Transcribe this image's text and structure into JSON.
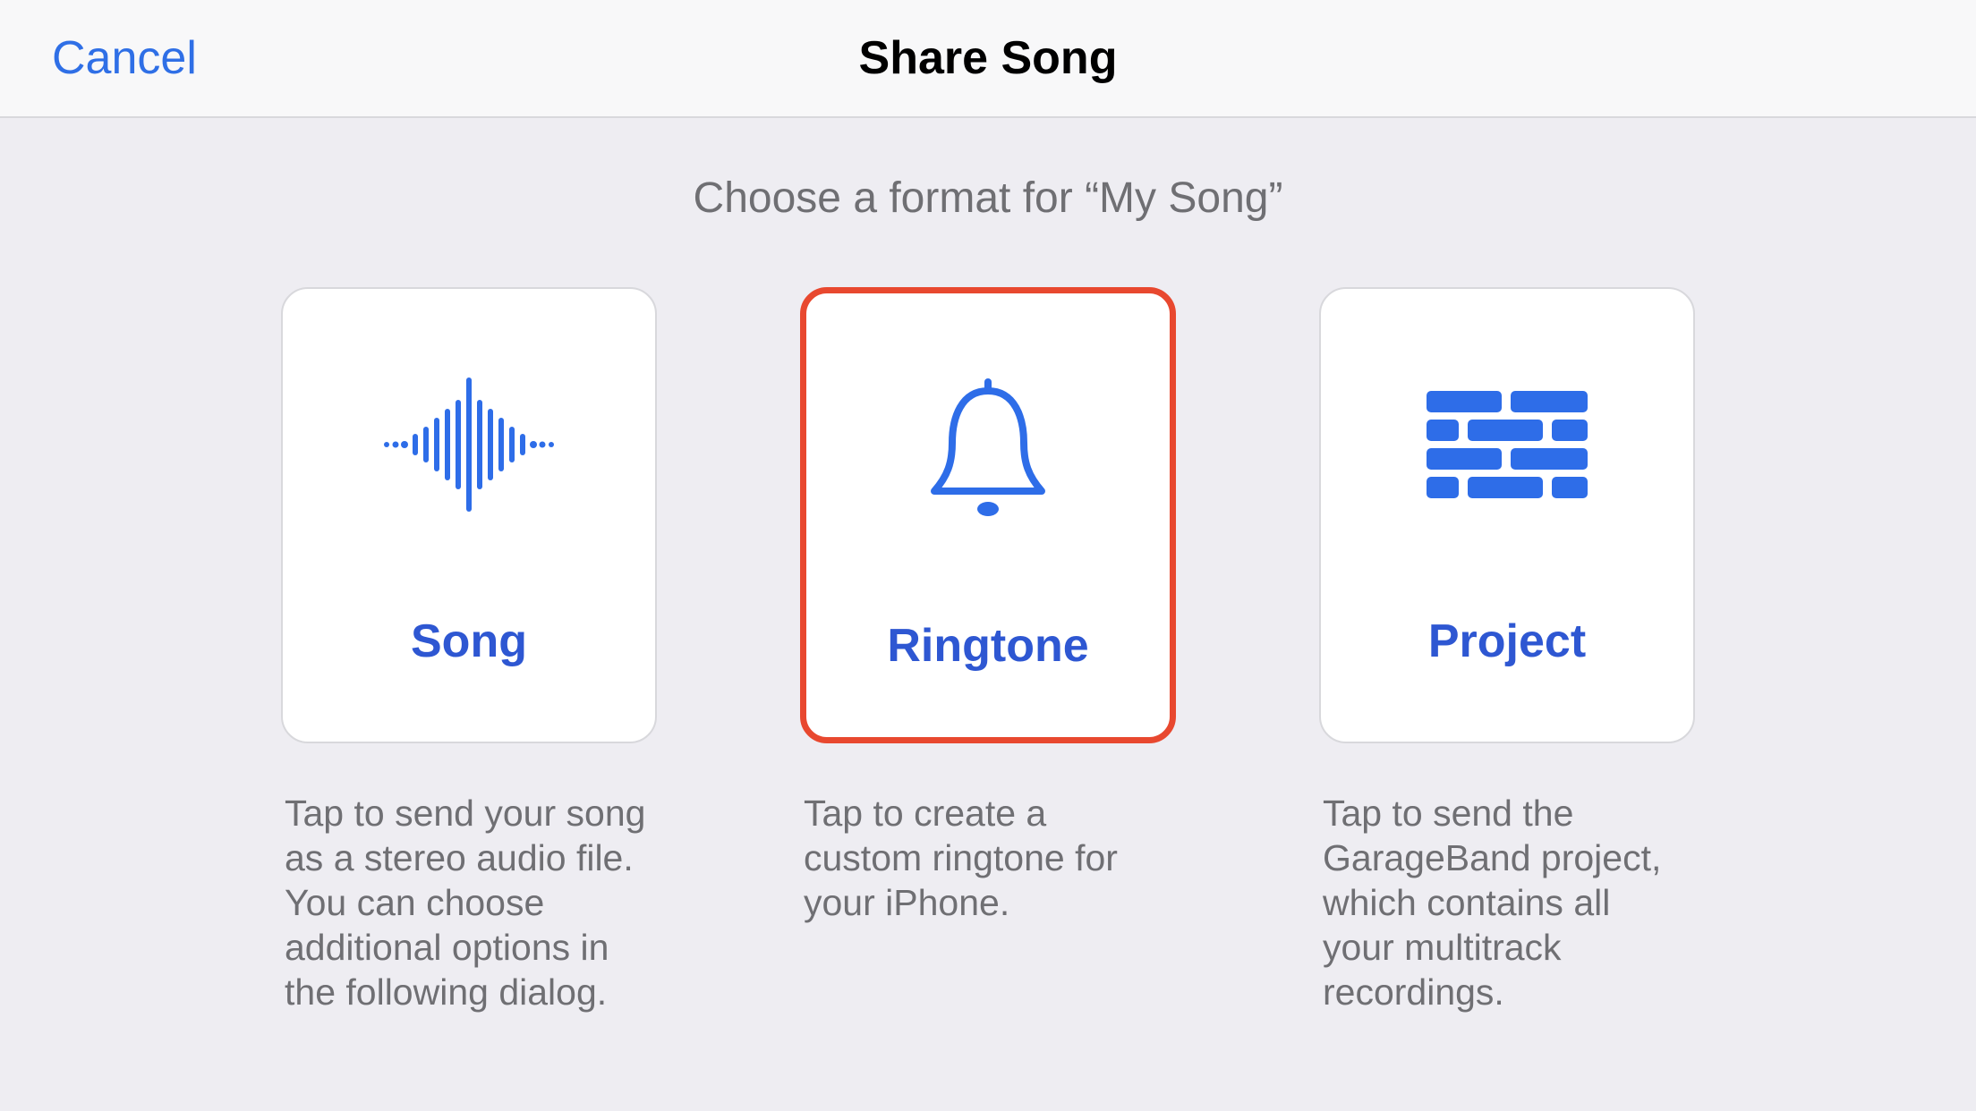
{
  "header": {
    "cancel_label": "Cancel",
    "title": "Share Song"
  },
  "subtitle": "Choose a format for “My Song”",
  "options": {
    "song": {
      "label": "Song",
      "description": "Tap to send your song as a stereo audio file. You can choose additional options in the following dialog.",
      "icon": "waveform-icon"
    },
    "ringtone": {
      "label": "Ringtone",
      "description": "Tap to create a custom ringtone for your iPhone.",
      "icon": "bell-icon",
      "highlighted": true
    },
    "project": {
      "label": "Project",
      "description": "Tap to send the GarageBand project, which contains all your multitrack recordings.",
      "icon": "bricks-icon"
    }
  },
  "colors": {
    "accent_blue": "#2e57d2",
    "link_blue": "#2f6fe6",
    "highlight_red": "#e8482f",
    "bg": "#eeedf2",
    "header_bg": "#f8f8f9",
    "card_bg": "#ffffff",
    "text_gray": "#6f6f73",
    "border": "#d8d8dc"
  }
}
